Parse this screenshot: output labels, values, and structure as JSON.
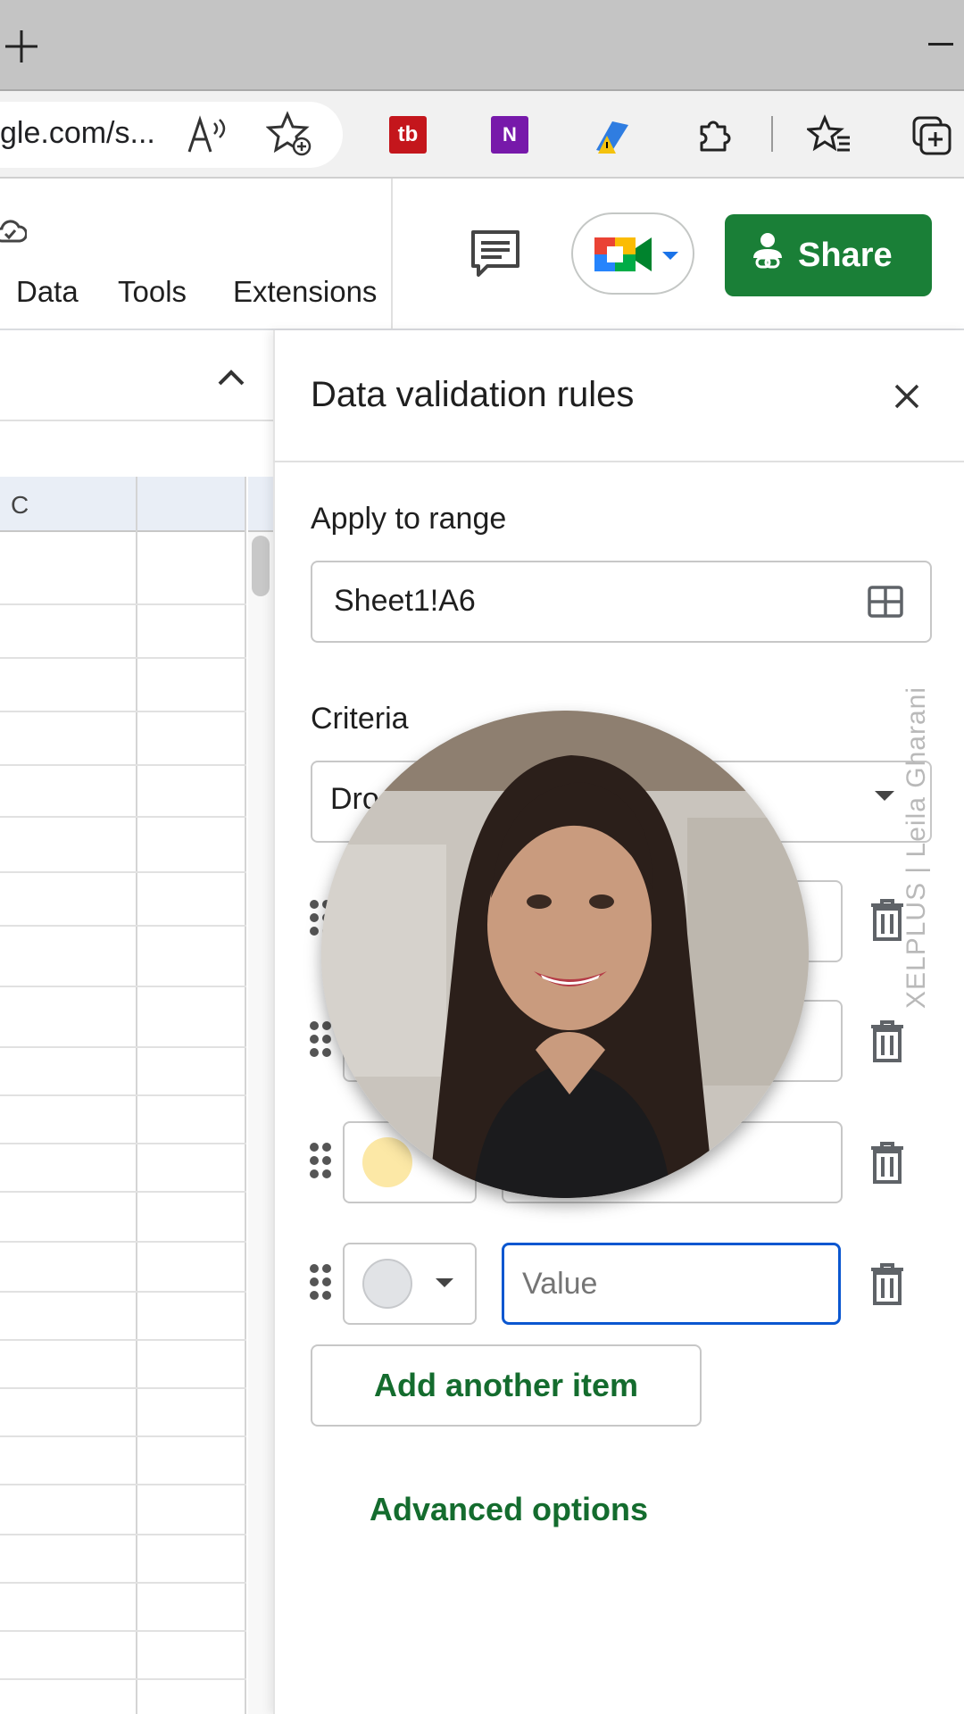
{
  "browser": {
    "url_text": "gle.com/s...",
    "extensions": {
      "tb_label": "tb",
      "onenote_label": "N"
    }
  },
  "sheets": {
    "menu": [
      "Data",
      "Tools",
      "Extensions"
    ],
    "share_label": "Share",
    "column_header": "C"
  },
  "panel": {
    "title": "Data validation rules",
    "apply_label": "Apply to range",
    "range_value": "Sheet1!A6",
    "criteria_label": "Criteria",
    "criteria_value_visible": "Dro",
    "items": [
      {
        "color": "#f5f5f5",
        "value": ""
      },
      {
        "color": "#f5f5f5",
        "value": ""
      },
      {
        "color": "#fce8a6",
        "value": ""
      },
      {
        "color": "#e1e3e6",
        "value": "",
        "placeholder": "Value"
      }
    ],
    "add_item_label": "Add another item",
    "advanced_label": "Advanced options"
  },
  "overlay": {
    "watermark": "XELPLUS | Leila Gharani"
  }
}
